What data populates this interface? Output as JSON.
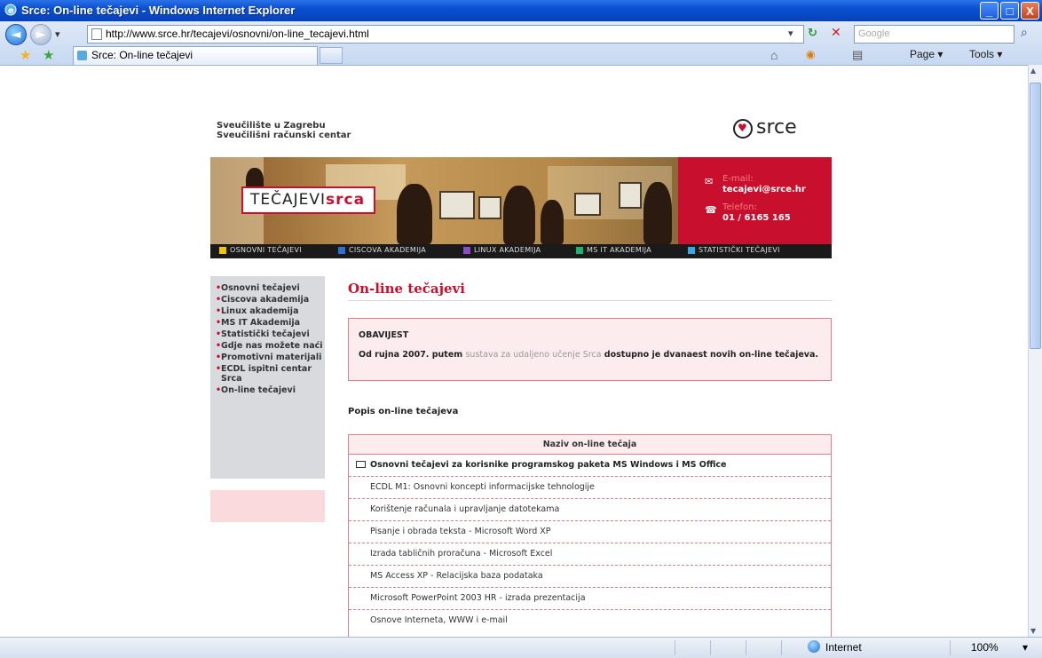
{
  "window": {
    "title": "Srce: On-line tečajevi - Windows Internet Explorer",
    "minimize_glyph": "_",
    "maximize_glyph": "□",
    "close_glyph": "X"
  },
  "browser": {
    "back_glyph": "◄",
    "forward_glyph": "►",
    "dropdown_glyph": "▾",
    "url": "http://www.srce.hr/tecajevi/osnovni/on-line_tecajevi.html",
    "search_placeholder": "Google",
    "refresh_glyph": "↻",
    "stop_glyph": "✕",
    "search_glyph": "⌕",
    "tab_title": "Srce: On-line tečajevi",
    "favorites_star_glyph": "★",
    "add_favorite_glyph": "★",
    "toolbar": {
      "home_glyph": "⌂",
      "feeds_glyph": "◉",
      "print_glyph": "▤",
      "page_label": "Page ▾",
      "tools_label": "Tools ▾"
    }
  },
  "statusbar": {
    "zone_label": "Internet",
    "zoom_label": "100%",
    "zoom_dropdown": "▾"
  },
  "site": {
    "university": "Sveučilište u Zagrebu",
    "center": "Sveučilišni računski centar",
    "logo_text": "srce",
    "logo_heart": "♥"
  },
  "banner": {
    "brand_plain": "TEČAJEVI",
    "brand_bold": "srca",
    "email_label": "E-mail:",
    "email_value": "tecajevi@srce.hr",
    "phone_label": "Telefon:",
    "phone_value": "01 / 6165 165",
    "email_icon": "✉",
    "phone_icon": "☎",
    "nav": [
      {
        "label": "OSNOVNI TEČAJEVI",
        "color": "#f2c500"
      },
      {
        "label": "CISCOVA AKADEMIJA",
        "color": "#2e6fd0"
      },
      {
        "label": "LINUX AKADEMIJA",
        "color": "#8a4bc6"
      },
      {
        "label": "MS IT AKADEMIJA",
        "color": "#20b070"
      },
      {
        "label": "STATISTIČKI TEČAJEVI",
        "color": "#3aa4e8"
      }
    ]
  },
  "sidebar": {
    "items": [
      "Osnovni tečajevi",
      "Ciscova akademija",
      "Linux akademija",
      "MS IT Akademija",
      "Statistički tečajevi",
      "Gdje nas možete naći",
      "Promotivni materijali",
      "ECDL ispitni centar Srca",
      "On-line tečajevi"
    ]
  },
  "main": {
    "title": "On-line tečajevi",
    "notice_heading": "OBAVIJEST",
    "notice_text_before": "Od rujna 2007. putem ",
    "notice_link": "sustava za udaljeno učenje Srca",
    "notice_text_after": " dostupno je dvanaest novih on-line tečajeva.",
    "list_heading": "Popis on-line tečajeva",
    "table_header": "Naziv on-line tečaja",
    "group_title": "Osnovni tečajevi za korisnike programskog paketa MS Windows i MS Office",
    "courses": [
      "ECDL M1: Osnovni koncepti informacijske tehnologije",
      "Korištenje računala i upravljanje datotekama",
      "Pisanje i obrada teksta - Microsoft Word XP",
      "Izrada tabličnih proračuna - Microsoft Excel",
      "MS Access XP - Relacijska baza podataka",
      "Microsoft PowerPoint 2003 HR - izrada prezentacija",
      "Osnove Interneta, WWW i e-mail"
    ]
  },
  "colors": {
    "accent": "#c8102e",
    "notice_bg": "#fdecee",
    "sidebar_bg": "#d8dadd",
    "titlebar": "#0a4fd0"
  }
}
